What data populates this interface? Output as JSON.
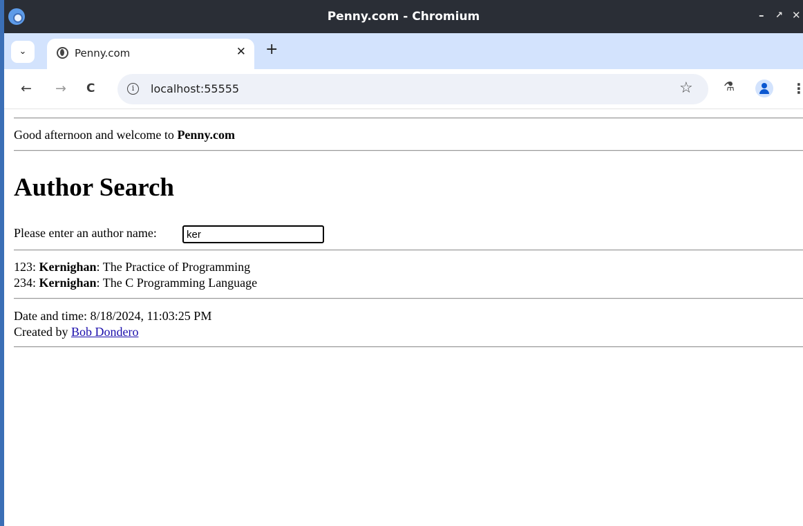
{
  "window": {
    "title": "Penny.com - Chromium",
    "controls": [
      "–",
      "↗",
      "✕"
    ]
  },
  "tabs": [
    {
      "label": "Penny.com",
      "close": "✕"
    }
  ],
  "tabstrip": {
    "menu_glyph": "⌄",
    "new_tab": "+"
  },
  "toolbar": {
    "back": "←",
    "forward": "→",
    "reload": "C",
    "url": "localhost:55555",
    "info_glyph": "i",
    "star_glyph": "☆",
    "lab_glyph": "⚗",
    "menu_glyph": "⋮"
  },
  "page": {
    "welcome_prefix": "Good afternoon and welcome to ",
    "site_name": "Penny.com",
    "heading": "Author Search",
    "prompt": "Please enter an author name:",
    "search_value": "ker",
    "results": [
      {
        "id": "123",
        "author": "Kernighan",
        "title": "The Practice of Programming"
      },
      {
        "id": "234",
        "author": "Kernighan",
        "title": "The C Programming Language"
      }
    ],
    "datetime_label": "Date and time:",
    "datetime_value": "8/18/2024, 11:03:25 PM",
    "created_by_label": "Created by",
    "creator": "Bob Dondero"
  }
}
